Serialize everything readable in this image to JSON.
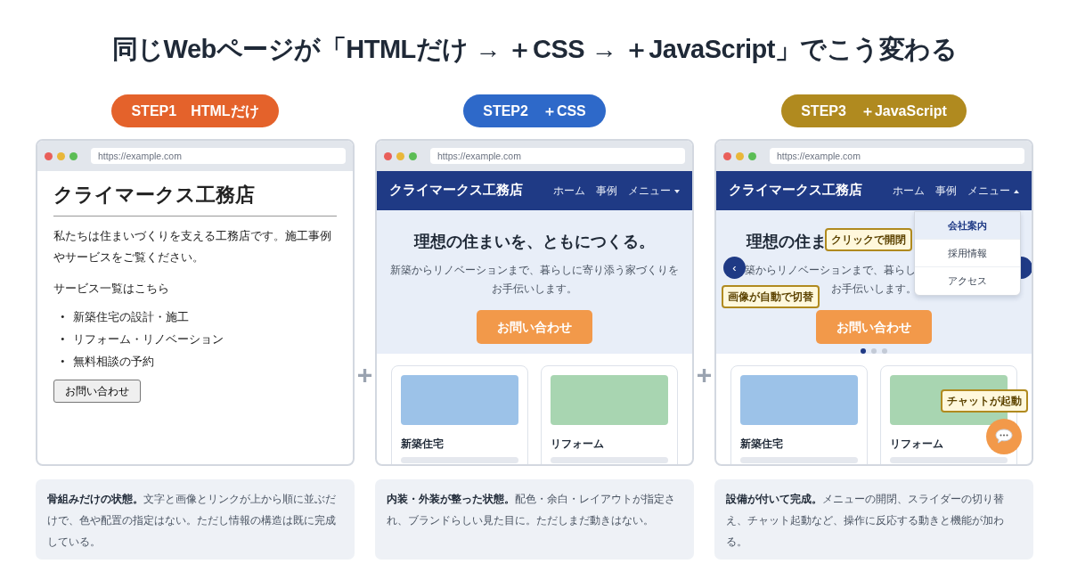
{
  "title": "同じWebページが「HTMLだけ → ＋CSS → ＋JavaScript」でこう変わる",
  "plus_signs": [
    "+",
    "+"
  ],
  "panels": [
    {
      "badge": {
        "label": "STEP1　HTMLだけ",
        "color": "#e4622b"
      },
      "url": "https://example.com",
      "kind": "plain",
      "heading": "クライマークス工務店",
      "paragraph": "私たちは住まいづくりを支える工務店です。施工事例やサービスをご覧ください。",
      "link": "サービス一覧はこちら",
      "list_marker": "•",
      "list": [
        "新築住宅の設計・施工",
        "リフォーム・リノベーション",
        "無料相談の予約"
      ],
      "button": "お問い合わせ",
      "caption": "**骨組みだけの状態。**文字と画像とリンクが上から順に並ぶだけで、色や配置の指定はない。ただし情報の構造は既に完成している。"
    },
    {
      "badge": {
        "label": "STEP2　＋CSS",
        "color": "#2e69c9"
      },
      "url": "https://example.com",
      "kind": "styled",
      "brand": "クライマークス工務店",
      "nav": [
        {
          "label": "ホーム",
          "kind": "link"
        },
        {
          "label": "事例",
          "kind": "link"
        },
        {
          "label": "メニュー",
          "kind": "dropdown",
          "expanded": false
        }
      ],
      "hero_title": "理想の住まいを、ともにつくる。",
      "hero_lines": [
        "新築からリノベーションまで、暮らしに寄り添う家づくりを",
        "お手伝いします。"
      ],
      "cta": "お問い合わせ",
      "cards": [
        {
          "title": "新築住宅",
          "color": "#9cc2e8"
        },
        {
          "title": "リフォーム",
          "color": "#a8d5b1"
        }
      ],
      "caption": "**内装・外装が整った状態。**配色・余白・レイアウトが指定され、ブランドらしい見た目に。ただしまだ動きはない。"
    },
    {
      "badge": {
        "label": "STEP3　＋JavaScript",
        "color": "#b08a1f"
      },
      "url": "https://example.com",
      "kind": "interactive",
      "brand": "クライマークス工務店",
      "nav": [
        {
          "label": "ホーム",
          "kind": "link"
        },
        {
          "label": "事例",
          "kind": "link"
        },
        {
          "label": "メニュー",
          "kind": "dropdown",
          "expanded": true
        }
      ],
      "dropdown": [
        {
          "label": "会社案内",
          "selected": true
        },
        {
          "label": "採用情報",
          "selected": false
        },
        {
          "label": "アクセス",
          "selected": false
        }
      ],
      "hero_title": "理想の住ま",
      "hero_lines": [
        "築からリノベーションまで、暮らし",
        "お手伝いします。"
      ],
      "cta": "お問い合わせ",
      "prev_arrow": "‹",
      "carousel_dots": [
        {
          "selected": true
        },
        {
          "selected": false
        },
        {
          "selected": false
        }
      ],
      "cards": [
        {
          "title": "新築住宅",
          "color": "#9cc2e8"
        },
        {
          "title": "リフォーム",
          "color": "#a8d5b1"
        }
      ],
      "callouts": [
        {
          "label": "クリックで開閉",
          "kind": "menu"
        },
        {
          "label": "画像が自動で切替",
          "kind": "slider"
        },
        {
          "label": "チャットが起動",
          "kind": "chat"
        }
      ],
      "chat": true,
      "caption": "**設備が付いて完成。**メニューの開閉、スライダーの切り替え、チャット起動など、操作に反応する動きと機能が加わる。"
    }
  ]
}
